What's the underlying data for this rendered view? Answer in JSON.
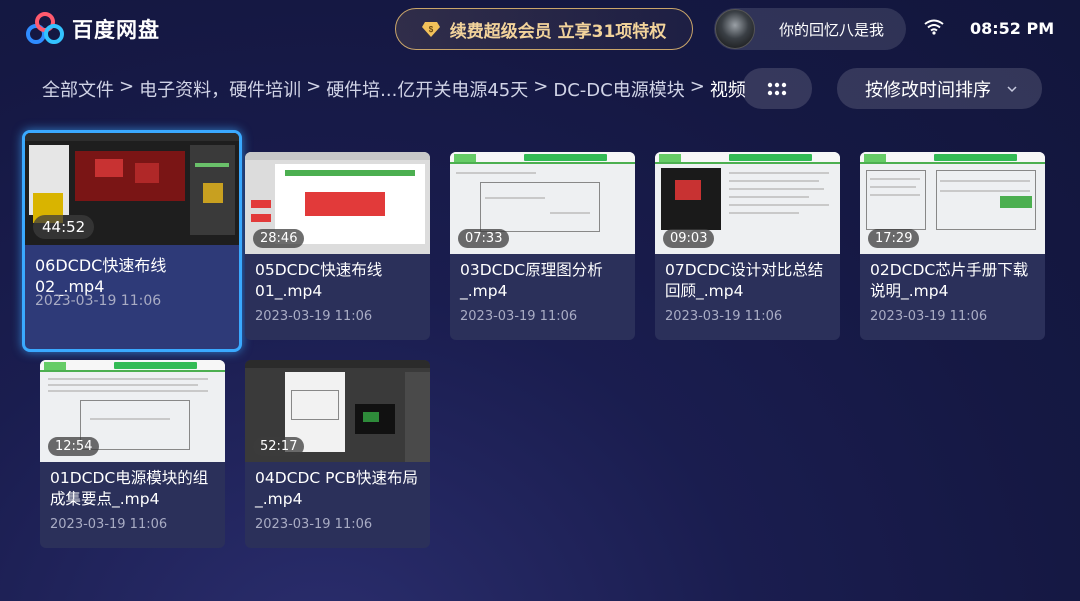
{
  "app": {
    "name": "百度网盘",
    "vip_label": "续费超级会员 立享31项特权",
    "user_name": "你的回忆八是我",
    "time": "08:52 PM"
  },
  "breadcrumb": [
    "全部文件",
    "电子资料，硬件培训",
    "硬件培...亿开关电源45天",
    "DC-DC电源模块",
    "视频"
  ],
  "breadcrumb_sep": ">",
  "toolbar": {
    "sort_label": "按修改时间排序"
  },
  "files": [
    {
      "name": "06DCDC快速布线02_.mp4",
      "duration": "44:52",
      "date": "2023-03-19  11:06",
      "selected": true
    },
    {
      "name": "05DCDC快速布线01_.mp4",
      "duration": "28:46",
      "date": "2023-03-19  11:06"
    },
    {
      "name": "03DCDC原理图分析_.mp4",
      "duration": "07:33",
      "date": "2023-03-19  11:06"
    },
    {
      "name": "07DCDC设计对比总结回顾_.mp4",
      "duration": "09:03",
      "date": "2023-03-19  11:06"
    },
    {
      "name": "02DCDC芯片手册下载说明_.mp4",
      "duration": "17:29",
      "date": "2023-03-19  11:06"
    },
    {
      "name": "01DCDC电源模块的组成集要点_.mp4",
      "duration": "12:54",
      "date": "2023-03-19  11:06"
    },
    {
      "name": "04DCDC PCB快速布局_.mp4",
      "duration": "52:17",
      "date": "2023-03-19  11:06"
    }
  ]
}
